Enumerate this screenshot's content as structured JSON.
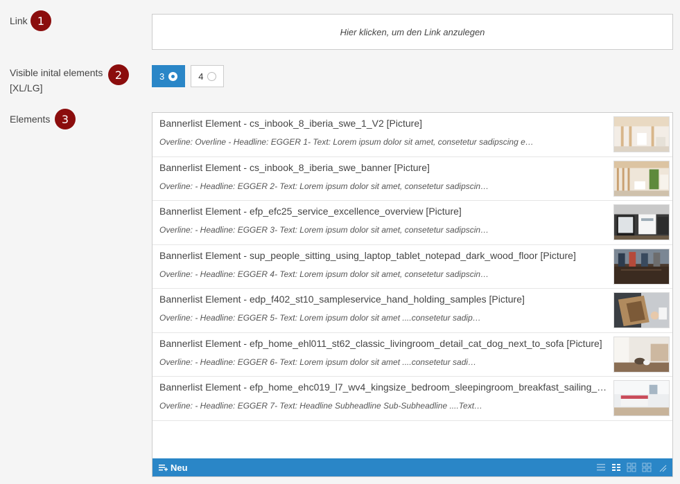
{
  "fields": {
    "link": {
      "label": "Link",
      "badge": "1",
      "placeholder_text": "Hier klicken, um den Link anzulegen"
    },
    "visible": {
      "label_line1": "Visible inital elements",
      "label_line2": "[XL/LG]",
      "badge": "2",
      "options": [
        "3",
        "4"
      ],
      "selected": "3"
    },
    "elements": {
      "label": "Elements",
      "badge": "3"
    }
  },
  "elements_list": [
    {
      "title": "Bannerlist Element - cs_inbook_8_iberia_swe_1_V2 [Picture]",
      "desc": "Overline: Overline - Headline: EGGER 1- Text: Lorem ipsum dolor sit amet, consetetur sadipscing elitr"
    },
    {
      "title": "Bannerlist Element - cs_inbook_8_iberia_swe_banner [Picture]",
      "desc": "Overline: - Headline: EGGER 2- Text: Lorem ipsum dolor sit amet, consetetur sadipscin…"
    },
    {
      "title": "Bannerlist Element - efp_efc25_service_excellence_overview [Picture]",
      "desc": "Overline: - Headline: EGGER 3- Text: Lorem ipsum dolor sit amet, consetetur sadipscin…"
    },
    {
      "title": "Bannerlist Element - sup_people_sitting_using_laptop_tablet_notepad_dark_wood_floor [Picture]",
      "desc": "Overline: - Headline: EGGER 4- Text: Lorem ipsum dolor sit amet, consetetur sadipscin…"
    },
    {
      "title": "Bannerlist Element - edp_f402_st10_sampleservice_hand_holding_samples [Picture]",
      "desc": "Overline: - Headline: EGGER 5- Text: Lorem ipsum dolor sit amet ....consetetur sadip…"
    },
    {
      "title": "Bannerlist Element - efp_home_ehl011_st62_classic_livingroom_detail_cat_dog_next_to_sofa [Picture]",
      "desc": "Overline: - Headline: EGGER 6- Text: Lorem ipsum dolor sit amet ....consetetur sadi…"
    },
    {
      "title": "Bannerlist Element - efp_home_ehc019_l7_wv4_kingsize_bedroom_sleepingroom_breakfast_sailing_boat [Picture]",
      "desc": "Overline: - Headline: EGGER 7- Text: Headline Subheadline Sub-Subheadline ....Text…"
    }
  ],
  "footer": {
    "new_label": "Neu"
  },
  "colors": {
    "accent": "#2a86c7",
    "badge": "#8b0d0d"
  },
  "icons": [
    "list-add-icon",
    "list-view-icon",
    "detail-view-icon",
    "tile-view-icon",
    "grid-view-icon",
    "resize-handle-icon"
  ]
}
